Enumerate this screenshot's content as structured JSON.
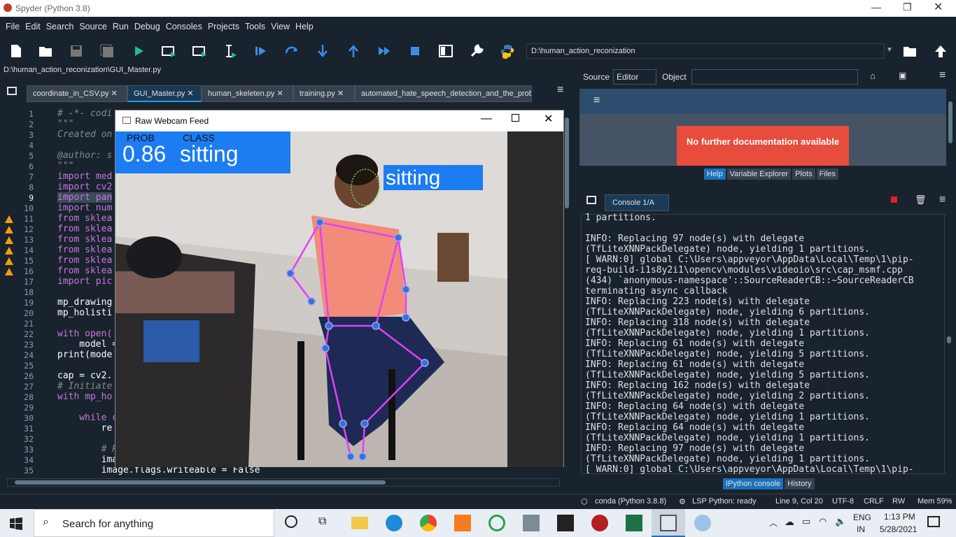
{
  "window": {
    "title": "Spyder (Python 3.8)"
  },
  "menus": [
    "File",
    "Edit",
    "Search",
    "Source",
    "Run",
    "Debug",
    "Consoles",
    "Projects",
    "Tools",
    "View",
    "Help"
  ],
  "toolbar": {
    "path": "D:\\human_action_reconization"
  },
  "editor": {
    "file_path": "D:\\human_action_reconization\\GUI_Master.py",
    "tabs": [
      "coordinate_in_CSV.py",
      "GUI_Master.py",
      "human_skeleten.py",
      "training.py",
      "automated_hate_speech_detection_and_the_prob"
    ],
    "lines": [
      {
        "n": "1",
        "t": "# -*- codi"
      },
      {
        "n": "2",
        "t": "\"\"\""
      },
      {
        "n": "3",
        "t": "Created on"
      },
      {
        "n": "4",
        "t": ""
      },
      {
        "n": "5",
        "t": "@author: s"
      },
      {
        "n": "6",
        "t": "\"\"\""
      },
      {
        "n": "7",
        "t": "import med"
      },
      {
        "n": "8",
        "t": "import cv2"
      },
      {
        "n": "9",
        "t": "import pan"
      },
      {
        "n": "10",
        "t": "import num"
      },
      {
        "n": "11",
        "t": "from sklea"
      },
      {
        "n": "12",
        "t": "from sklea"
      },
      {
        "n": "13",
        "t": "from sklea"
      },
      {
        "n": "14",
        "t": "from sklea"
      },
      {
        "n": "15",
        "t": "from sklea"
      },
      {
        "n": "16",
        "t": "from sklea"
      },
      {
        "n": "17",
        "t": "import pic"
      },
      {
        "n": "18",
        "t": ""
      },
      {
        "n": "19",
        "t": "mp_drawing"
      },
      {
        "n": "20",
        "t": "mp_holisti"
      },
      {
        "n": "21",
        "t": ""
      },
      {
        "n": "22",
        "t": "with open("
      },
      {
        "n": "23",
        "t": "    model ="
      },
      {
        "n": "24",
        "t": "print(mode"
      },
      {
        "n": "25",
        "t": ""
      },
      {
        "n": "26",
        "t": "cap = cv2."
      },
      {
        "n": "27",
        "t": "# Initiate"
      },
      {
        "n": "28",
        "t": "with mp_ho"
      },
      {
        "n": "29",
        "t": ""
      },
      {
        "n": "30",
        "t": "    while c"
      },
      {
        "n": "31",
        "t": "        re"
      },
      {
        "n": "32",
        "t": ""
      },
      {
        "n": "33",
        "t": "        # R"
      },
      {
        "n": "34",
        "t": "        ima"
      },
      {
        "n": "35",
        "t": "        image.flags.writeable = False"
      }
    ]
  },
  "webcam": {
    "title": "Raw Webcam Feed",
    "prob_label": "PROB",
    "class_label": "CLASS",
    "prob": "0.86",
    "class": "sitting",
    "pose_label": "sitting"
  },
  "help": {
    "source_label": "Source",
    "source_value": "Editor",
    "object_label": "Object",
    "message": "No further documentation available",
    "tabs": [
      "Help",
      "Variable Explorer",
      "Plots",
      "Files"
    ]
  },
  "console": {
    "tab": "Console 1/A",
    "lines": [
      "1 partitions.",
      "",
      "INFO: Replacing 97 node(s) with delegate",
      "(TfLiteXNNPackDelegate) node, yielding 1 partitions.",
      "[ WARN:0] global C:\\Users\\appveyor\\AppData\\Local\\Temp\\1\\pip-",
      "req-build-i1s8y2i1\\opencv\\modules\\videoio\\src\\cap_msmf.cpp",
      "(434) `anonymous-namespace'::SourceReaderCB::~SourceReaderCB",
      "terminating async callback",
      "INFO: Replacing 223 node(s) with delegate",
      "(TfLiteXNNPackDelegate) node, yielding 6 partitions.",
      "INFO: Replacing 318 node(s) with delegate",
      "(TfLiteXNNPackDelegate) node, yielding 1 partitions.",
      "INFO: Replacing 61 node(s) with delegate",
      "(TfLiteXNNPackDelegate) node, yielding 5 partitions.",
      "INFO: Replacing 61 node(s) with delegate",
      "(TfLiteXNNPackDelegate) node, yielding 5 partitions.",
      "INFO: Replacing 162 node(s) with delegate",
      "(TfLiteXNNPackDelegate) node, yielding 2 partitions.",
      "INFO: Replacing 64 node(s) with delegate",
      "(TfLiteXNNPackDelegate) node, yielding 1 partitions.",
      "INFO: Replacing 64 node(s) with delegate",
      "(TfLiteXNNPackDelegate) node, yielding 1 partitions.",
      "INFO: Replacing 97 node(s) with delegate",
      "(TfLiteXNNPackDelegate) node, yielding 1 partitions.",
      "[ WARN:0] global C:\\Users\\appveyor\\AppData\\Local\\Temp\\1\\pip-"
    ],
    "bottom_tabs": [
      "IPython console",
      "History"
    ]
  },
  "status": {
    "conda": "conda (Python 3.8.8)",
    "lsp": "LSP Python: ready",
    "position": "Line 9, Col 20",
    "encoding": "UTF-8",
    "eol": "CRLF",
    "mode": "RW",
    "mem": "Mem 59%"
  },
  "taskbar": {
    "search": "Search for anything",
    "lang1": "ENG",
    "lang2": "IN",
    "time": "1:13 PM",
    "date": "5/28/2021"
  }
}
